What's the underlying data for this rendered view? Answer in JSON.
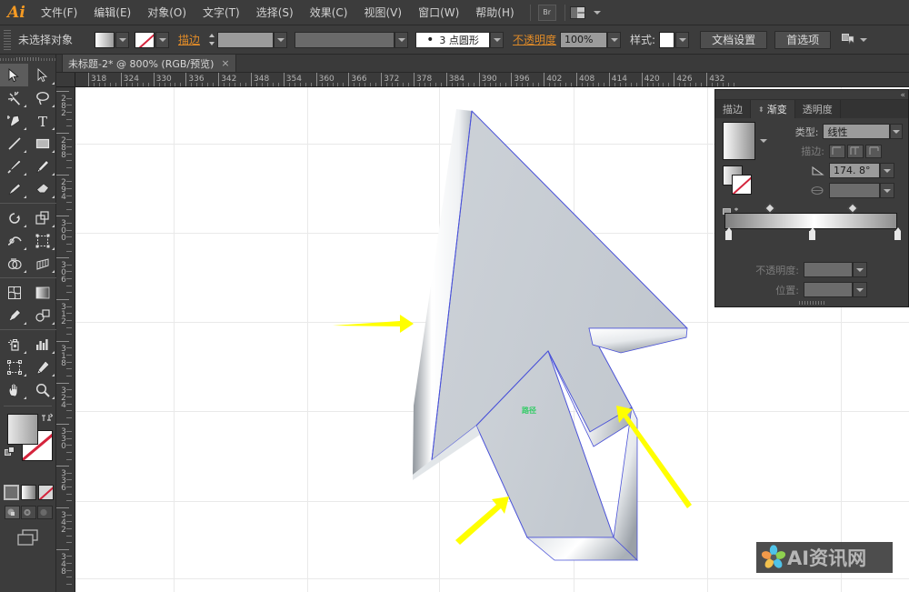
{
  "app": {
    "name": "Adobe Illustrator",
    "logo": "Ai"
  },
  "menubar": {
    "items": [
      {
        "label": "文件(F)",
        "name": "menu-file"
      },
      {
        "label": "编辑(E)",
        "name": "menu-edit"
      },
      {
        "label": "对象(O)",
        "name": "menu-object"
      },
      {
        "label": "文字(T)",
        "name": "menu-type"
      },
      {
        "label": "选择(S)",
        "name": "menu-select"
      },
      {
        "label": "效果(C)",
        "name": "menu-effect"
      },
      {
        "label": "视图(V)",
        "name": "menu-view"
      },
      {
        "label": "窗口(W)",
        "name": "menu-window"
      },
      {
        "label": "帮助(H)",
        "name": "menu-help"
      }
    ],
    "bridge_icon": "Br",
    "arrange_icon": "arrange-documents-icon"
  },
  "optionsbar": {
    "selection_status": "未选择对象",
    "fill_swatch": "gradient-white-gray",
    "stroke_swatch": "none",
    "stroke_label": "描边",
    "stroke_weight_value": "",
    "stroke_profile_value": "",
    "brush_definition": "3 点圆形",
    "opacity_label": "不透明度",
    "opacity_value": "100%",
    "style_label": "样式:",
    "style_swatch": "white",
    "document_setup": "文档设置",
    "preferences": "首选项",
    "select_similar_icon": "select-similar-objects-icon"
  },
  "tabbar": {
    "tab_title": "未标题-2* @ 800% (RGB/预览)",
    "close_glyph": "×"
  },
  "toolbar": {
    "tools": [
      {
        "name": "selection-tool",
        "active": true
      },
      {
        "name": "direct-selection-tool",
        "active": false
      },
      {
        "name": "magic-wand-tool",
        "active": false
      },
      {
        "name": "lasso-tool",
        "active": false
      },
      {
        "name": "pen-tool",
        "active": false
      },
      {
        "name": "type-tool",
        "active": false
      },
      {
        "name": "line-segment-tool",
        "active": false
      },
      {
        "name": "rectangle-tool",
        "active": false
      },
      {
        "name": "paintbrush-tool",
        "active": false
      },
      {
        "name": "pencil-tool",
        "active": false
      },
      {
        "name": "blob-brush-tool",
        "active": false
      },
      {
        "name": "eraser-tool",
        "active": false
      },
      {
        "name": "rotate-tool",
        "active": false
      },
      {
        "name": "scale-tool",
        "active": false
      },
      {
        "name": "width-tool",
        "active": false
      },
      {
        "name": "free-transform-tool",
        "active": false
      },
      {
        "name": "shape-builder-tool",
        "active": false
      },
      {
        "name": "perspective-grid-tool",
        "active": false
      },
      {
        "name": "mesh-tool",
        "active": false
      },
      {
        "name": "gradient-tool",
        "active": false
      },
      {
        "name": "eyedropper-tool",
        "active": false
      },
      {
        "name": "blend-tool",
        "active": false
      },
      {
        "name": "symbol-sprayer-tool",
        "active": false
      },
      {
        "name": "column-graph-tool",
        "active": false
      },
      {
        "name": "artboard-tool",
        "active": false
      },
      {
        "name": "slice-tool",
        "active": false
      },
      {
        "name": "hand-tool",
        "active": false
      },
      {
        "name": "zoom-tool",
        "active": false
      }
    ],
    "fill_color": "gradient-white-gray",
    "stroke_color": "none",
    "swap-icon": "swap-fill-stroke-icon",
    "default-icon": "default-fill-stroke-icon",
    "modes": [
      "color-mode",
      "gradient-mode",
      "none-mode"
    ],
    "screen_modes": [
      "normal-screen-mode",
      "full-screen-with-menu",
      "full-screen"
    ],
    "change_screen_icon": "change-screen-mode-icon"
  },
  "rulers": {
    "unit": "pt",
    "horizontal_labels": [
      "318",
      "324",
      "330",
      "336",
      "342",
      "348",
      "354",
      "360",
      "366",
      "372",
      "378",
      "384",
      "390",
      "396",
      "402",
      "408",
      "414",
      "420",
      "426",
      "432"
    ],
    "vertical_labels": [
      "282",
      "288",
      "294",
      "300",
      "306",
      "312",
      "318",
      "324",
      "330",
      "336",
      "342",
      "348"
    ]
  },
  "canvas": {
    "artwork_name": "3d-cursor-arrow-extrude",
    "fill": "#c9ced4",
    "path_outline_color": "#4a52d8",
    "smart_guide_label": "路径",
    "annotations": [
      {
        "name": "annotation-arrow-left",
        "direction": "right"
      },
      {
        "name": "annotation-arrow-bottom-left",
        "direction": "up-right"
      },
      {
        "name": "annotation-arrow-bottom-right",
        "direction": "up-left"
      }
    ],
    "annotation_color": "#ffff00"
  },
  "panel": {
    "tabs": [
      {
        "label": "描边",
        "name": "panel-tab-stroke",
        "active": false
      },
      {
        "label": "渐变",
        "name": "panel-tab-gradient",
        "active": true
      },
      {
        "label": "透明度",
        "name": "panel-tab-transparency",
        "active": false
      }
    ],
    "type_label": "类型:",
    "type_value": "线性",
    "stroke_label": "描边:",
    "stroke_options": [
      "stroke-within-gradient",
      "stroke-along-gradient",
      "stroke-across-gradient"
    ],
    "angle_label": "angle-icon",
    "angle_value": "174. 8°",
    "aspect_label": "aspect-ratio-icon",
    "aspect_value": "",
    "opacity_label": "不透明度:",
    "opacity_value": "",
    "location_label": "位置:",
    "location_value": "",
    "gradient_stops": [
      {
        "position": 0,
        "color": "#7e7e7e"
      },
      {
        "position": 52,
        "color": "#ffffff"
      },
      {
        "position": 100,
        "color": "#8e8e8e"
      }
    ],
    "collapse_icon": "collapse-to-icons-icon"
  },
  "watermark": {
    "text": "AI资讯网",
    "logo": "flower-logo"
  }
}
